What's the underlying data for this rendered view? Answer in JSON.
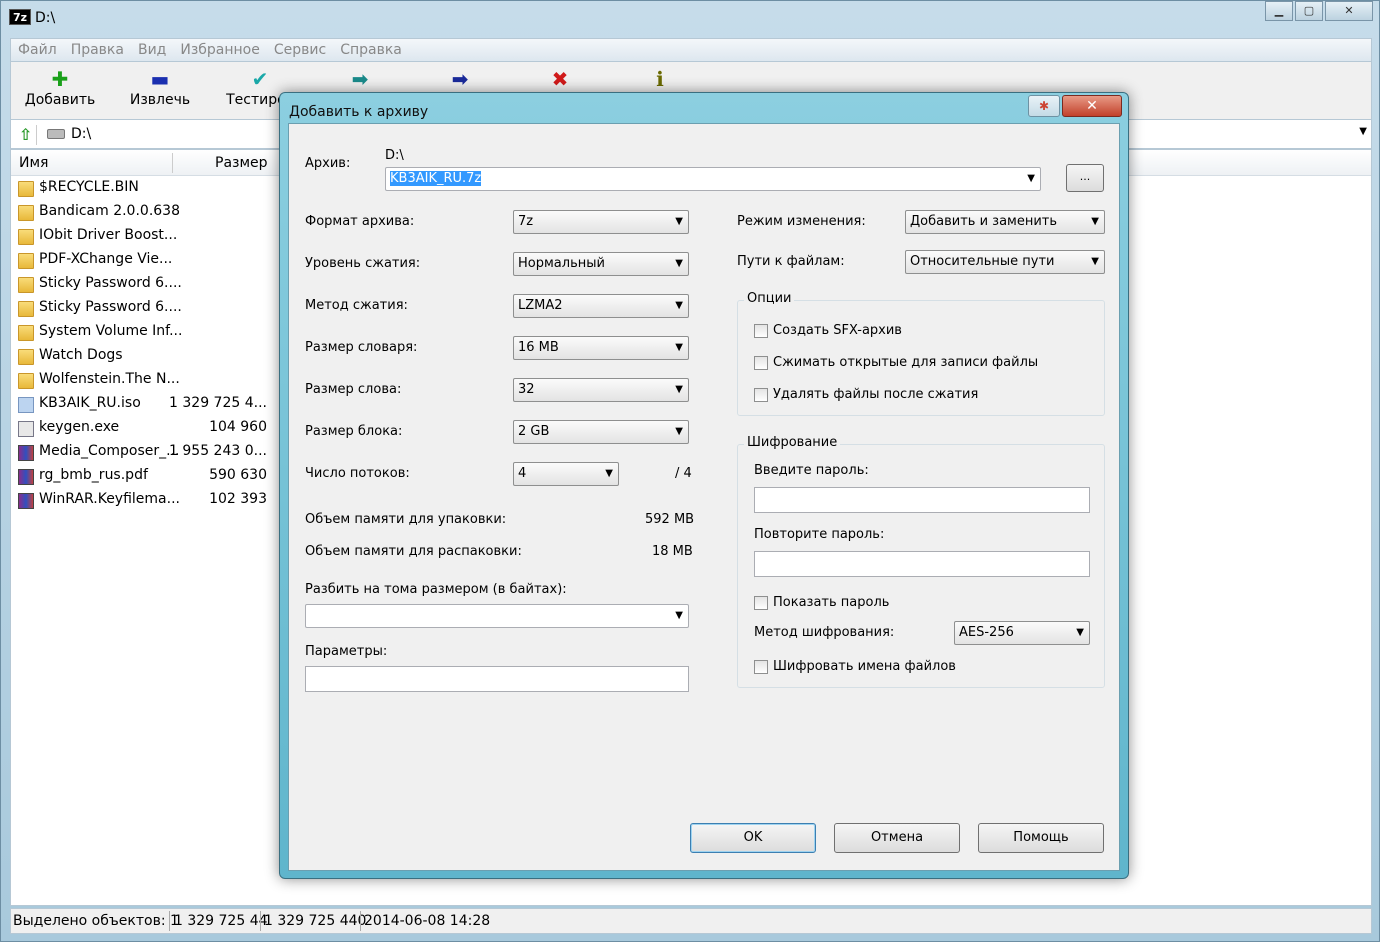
{
  "main": {
    "title": "D:\\",
    "app_icon": "7z",
    "window_buttons": {
      "minimize": "▁",
      "maximize": "▢",
      "close": "✕"
    },
    "menu": [
      "Файл",
      "Правка",
      "Вид",
      "Избранное",
      "Сервис",
      "Справка"
    ],
    "toolbar": [
      {
        "label": "Добавить",
        "icon": "add-icon",
        "glyph": "✚",
        "color": "#1aa01a"
      },
      {
        "label": "Извлечь",
        "icon": "extract-icon",
        "glyph": "▬",
        "color": "#1a2fb0"
      },
      {
        "label": "Тестиров",
        "icon": "test-icon",
        "glyph": "✔",
        "color": "#1aa8a8"
      },
      {
        "label": "",
        "icon": "copy-icon",
        "glyph": "➡",
        "color": "#1a8a8a"
      },
      {
        "label": "",
        "icon": "move-icon",
        "glyph": "➡",
        "color": "#1a2a9a"
      },
      {
        "label": "",
        "icon": "delete-icon",
        "glyph": "✖",
        "color": "#d01a1a"
      },
      {
        "label": "",
        "icon": "info-icon",
        "glyph": "ℹ",
        "color": "#6a6a00"
      }
    ],
    "address": "D:\\",
    "columns": {
      "name": "Имя",
      "size": "Размер"
    },
    "files": [
      {
        "name": "$RECYCLE.BIN",
        "size": "",
        "type": "folder"
      },
      {
        "name": "Bandicam 2.0.0.638",
        "size": "",
        "type": "folder"
      },
      {
        "name": "IObit Driver Boost...",
        "size": "",
        "type": "folder"
      },
      {
        "name": "PDF-XChange Vie...",
        "size": "",
        "type": "folder"
      },
      {
        "name": "Sticky Password 6....",
        "size": "",
        "type": "folder"
      },
      {
        "name": "Sticky Password 6....",
        "size": "",
        "type": "folder"
      },
      {
        "name": "System Volume Inf...",
        "size": "",
        "type": "folder"
      },
      {
        "name": "Watch Dogs",
        "size": "",
        "type": "folder"
      },
      {
        "name": "Wolfenstein.The N...",
        "size": "",
        "type": "folder"
      },
      {
        "name": "KB3AIK_RU.iso",
        "size": "1 329 725 4...",
        "type": "iso"
      },
      {
        "name": "keygen.exe",
        "size": "104 960",
        "type": "exe"
      },
      {
        "name": "Media_Composer_...",
        "size": "1 955 243 0...",
        "type": "rar"
      },
      {
        "name": "rg_bmb_rus.pdf",
        "size": "590 630",
        "type": "rar"
      },
      {
        "name": "WinRAR.Keyfilema...",
        "size": "102 393",
        "type": "rar"
      }
    ],
    "status": {
      "selected": "Выделено объектов: 1",
      "size1": "1 329 725 44",
      "size2": "1 329 725 440",
      "date": "2014-06-08 14:28"
    }
  },
  "dialog": {
    "title": "Добавить к архиву",
    "close_label": "✕",
    "archive_label": "Архив:",
    "archive_path": "D:\\",
    "archive_name": "KB3AIK_RU.7z",
    "browse_label": "...",
    "format_label": "Формат архива:",
    "format_value": "7z",
    "level_label": "Уровень сжатия:",
    "level_value": "Нормальный",
    "method_label": "Метод сжатия:",
    "method_value": "LZMA2",
    "dict_label": "Размер словаря:",
    "dict_value": "16 MB",
    "word_label": "Размер слова:",
    "word_value": "32",
    "block_label": "Размер блока:",
    "block_value": "2 GB",
    "threads_label": "Число потоков:",
    "threads_value": "4",
    "threads_max": "/ 4",
    "mem_pack_label": "Объем памяти для упаковки:",
    "mem_pack_value": "592 MB",
    "mem_unpack_label": "Объем памяти для распаковки:",
    "mem_unpack_value": "18 MB",
    "split_label": "Разбить на тома размером (в байтах):",
    "split_value": "",
    "params_label": "Параметры:",
    "params_value": "",
    "update_label": "Режим изменения:",
    "update_value": "Добавить и заменить",
    "paths_label": "Пути к файлам:",
    "paths_value": "Относительные пути",
    "options_title": "Опции",
    "opt_sfx": "Создать SFX-архив",
    "opt_shared": "Сжимать открытые для записи файлы",
    "opt_delete": "Удалять файлы после сжатия",
    "encryption_title": "Шифрование",
    "password_label": "Введите пароль:",
    "password_value": "",
    "repeat_label": "Повторите пароль:",
    "repeat_value": "",
    "show_password": "Показать пароль",
    "enc_method_label": "Метод шифрования:",
    "enc_method_value": "AES-256",
    "encrypt_names": "Шифровать имена файлов",
    "ok": "OK",
    "cancel": "Отмена",
    "help": "Помощь"
  }
}
